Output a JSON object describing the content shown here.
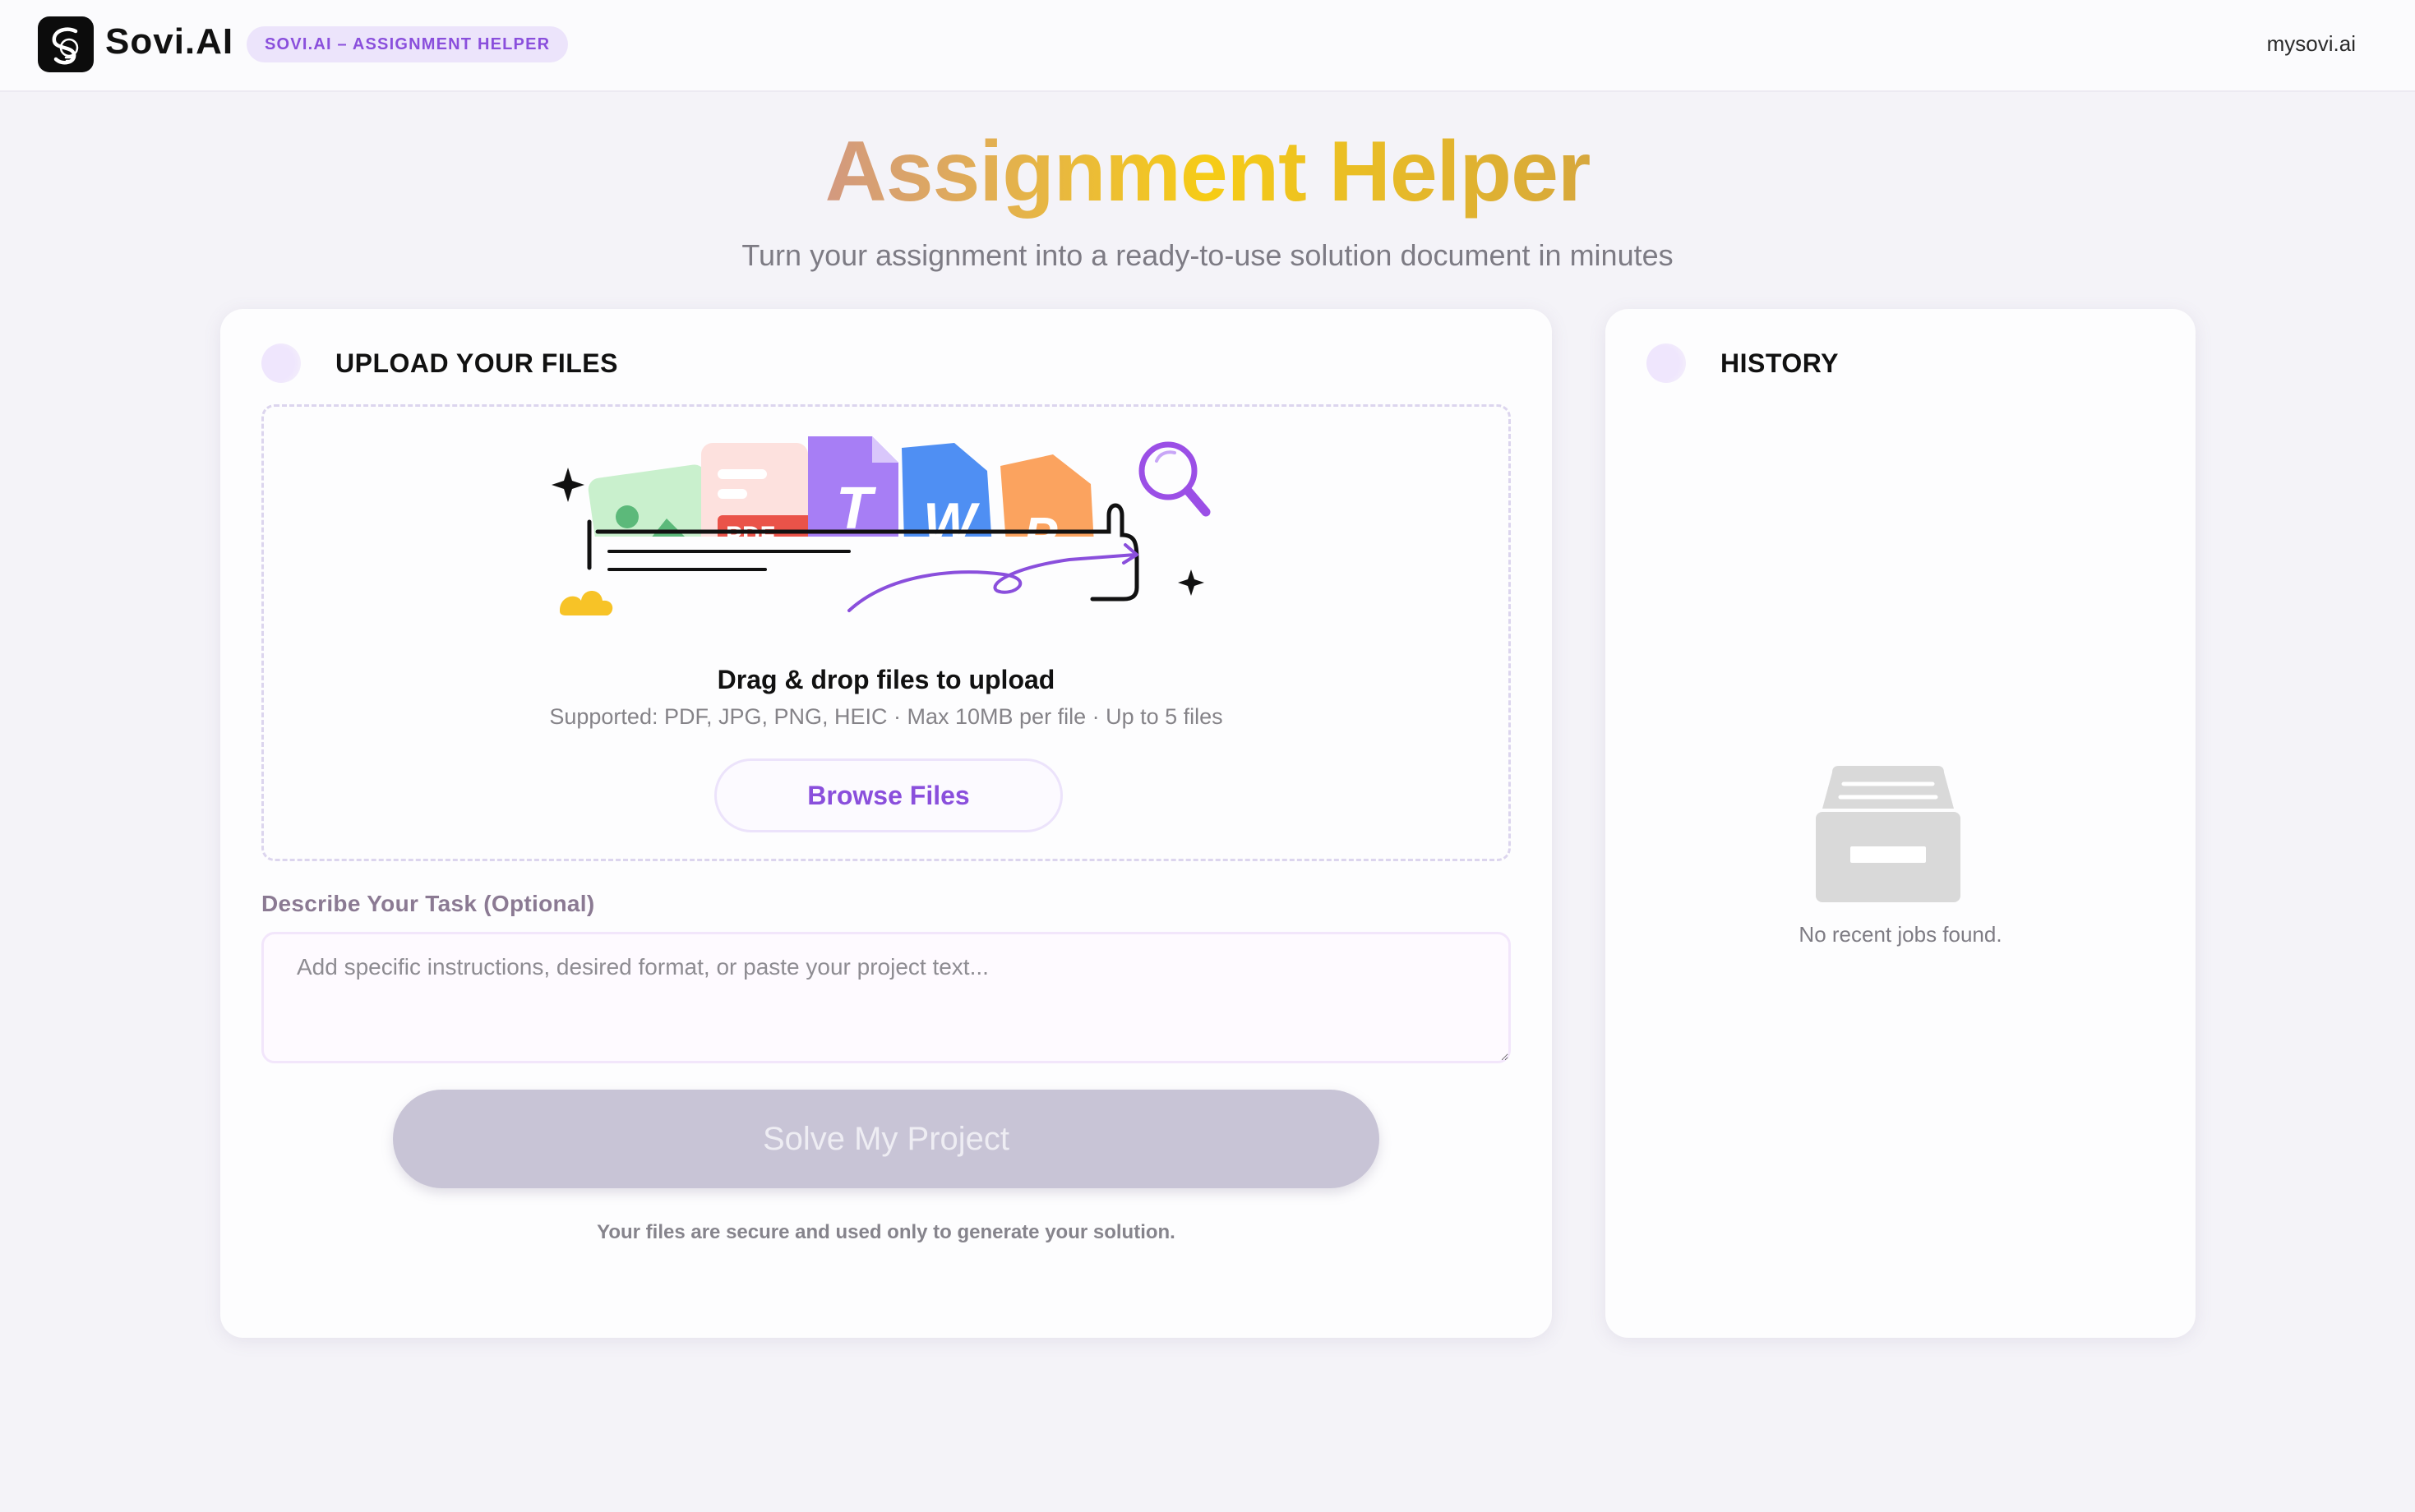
{
  "header": {
    "brand": "Sovi.AI",
    "badge": "SOVI.AI – ASSIGNMENT HELPER",
    "site_link": "mysovi.ai"
  },
  "hero": {
    "title": "Assignment Helper",
    "subtitle": "Turn your assignment into a ready-to-use solution document in minutes"
  },
  "upload": {
    "title": "UPLOAD YOUR FILES",
    "drop_title": "Drag & drop files to upload",
    "drop_sub": "Supported: PDF, JPG, PNG, HEIC · Max 10MB per file · Up to 5 files",
    "browse_label": "Browse Files",
    "illustration_letters": [
      "PDF",
      "T",
      "W",
      "P"
    ],
    "task_label": "Describe Your Task (Optional)",
    "task_placeholder": "Add specific instructions, desired format, or paste your project text...",
    "task_value": "",
    "solve_label": "Solve My Project",
    "solve_enabled": false,
    "secure_note": "Your files are secure and used only to generate your solution."
  },
  "history": {
    "title": "HISTORY",
    "empty_text": "No recent jobs found.",
    "empty_icon": "archive-box-icon"
  },
  "colors": {
    "accent": "#8a4fdc",
    "badge_bg": "#ece4fb",
    "solve_disabled": "#c8c4d6",
    "page_bg": "#f4f3f8"
  }
}
